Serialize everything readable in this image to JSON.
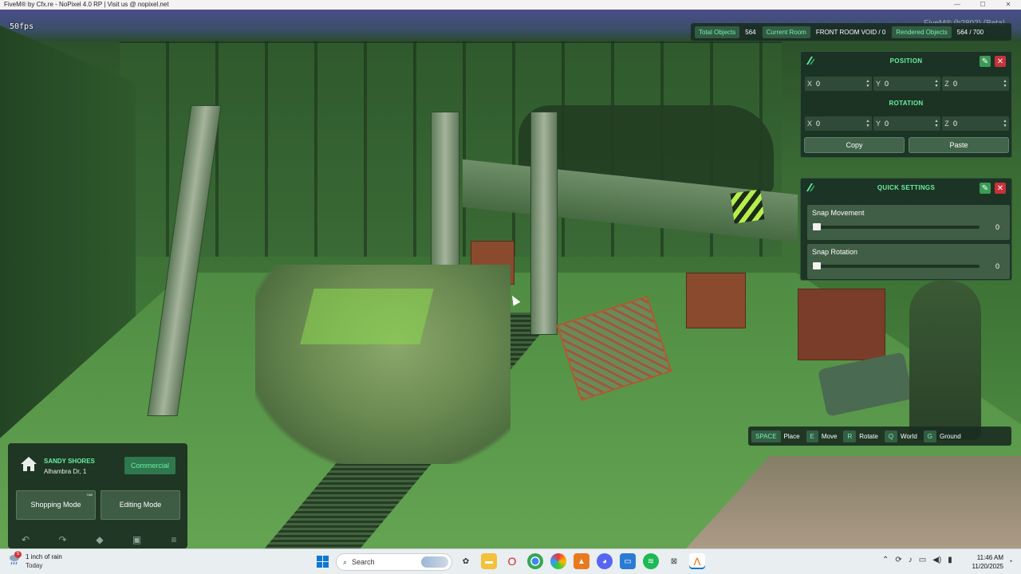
{
  "window": {
    "title": "FiveM® by Cfx.re - NoPixel 4.0 RP | Visit us @ nopixel.net",
    "minimize": "—",
    "maximize": "☐",
    "close": "✕"
  },
  "hud": {
    "fps": "50fps",
    "fivem_version": "FiveM® (b2802) (Beta)"
  },
  "stats": {
    "total_objects_label": "Total Objects",
    "total_objects_value": "564",
    "current_room_label": "Current Room",
    "current_room_value": "FRONT ROOM VOID / 0",
    "rendered_objects_label": "Rendered Objects",
    "rendered_objects_value": "564 / 700"
  },
  "position_panel": {
    "position_title": "POSITION",
    "rotation_title": "ROTATION",
    "position": [
      {
        "axis": "X",
        "value": "0"
      },
      {
        "axis": "Y",
        "value": "0"
      },
      {
        "axis": "Z",
        "value": "0"
      }
    ],
    "rotation": [
      {
        "axis": "X",
        "value": "0"
      },
      {
        "axis": "Y",
        "value": "0"
      },
      {
        "axis": "Z",
        "value": "0"
      }
    ],
    "copy_label": "Copy",
    "paste_label": "Paste"
  },
  "quick_settings": {
    "title": "QUICK SETTINGS",
    "items": [
      {
        "label": "Snap Movement",
        "value": "0",
        "level": 0
      },
      {
        "label": "Snap Rotation",
        "value": "0",
        "level": 0
      }
    ]
  },
  "keybinds": [
    {
      "key": "SPACE",
      "action": "Place"
    },
    {
      "key": "E",
      "action": "Move"
    },
    {
      "key": "R",
      "action": "Rotate"
    },
    {
      "key": "Q",
      "action": "World"
    },
    {
      "key": "G",
      "action": "Ground"
    }
  ],
  "property": {
    "name": "SANDY SHORES",
    "address": "Alhambra Dr, 1",
    "type": "Commercial",
    "shopping_mode": "Shopping Mode",
    "shopping_key": "TAB",
    "editing_mode": "Editing Mode",
    "tools": [
      "undo-icon",
      "redo-icon",
      "eraser-icon",
      "save-icon",
      "sliders-icon"
    ]
  },
  "taskbar": {
    "weather_line1": "1 inch of rain",
    "weather_line2": "Today",
    "weather_badge": "5",
    "search_placeholder": "Search",
    "time": "11:46 AM",
    "date": "11/20/2025",
    "accent": "#0a78d4"
  },
  "colors": {
    "accent_green": "#6af0a4",
    "close_red": "#c8323a",
    "edit_green": "#3b9a55"
  }
}
